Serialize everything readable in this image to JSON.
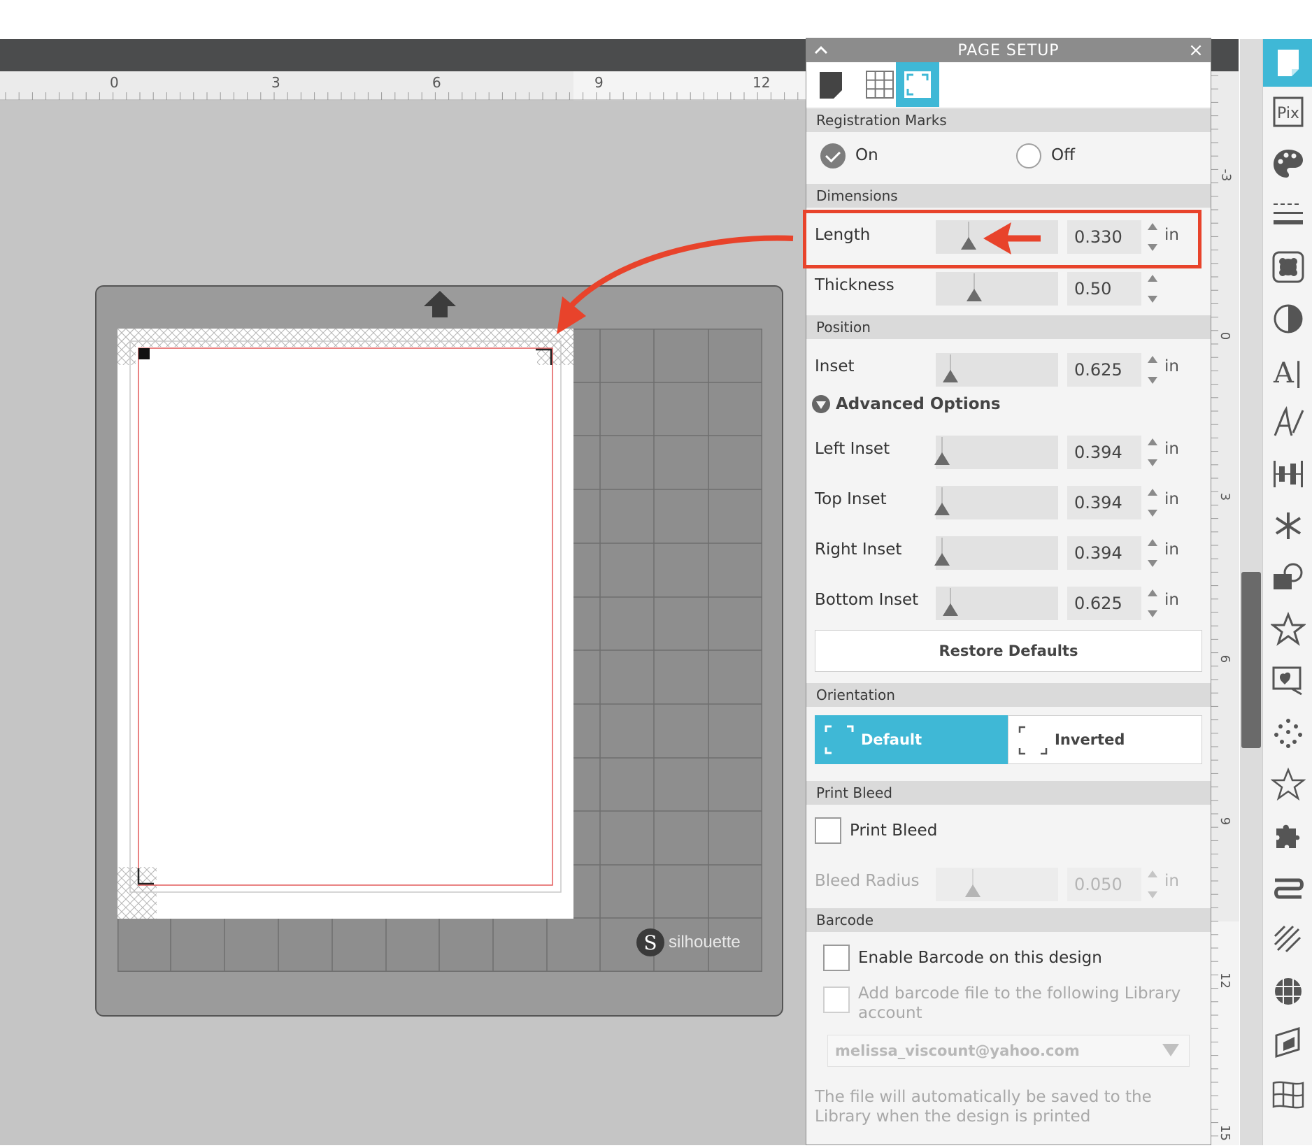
{
  "ruler": {
    "h_ticks": [
      "0",
      "3",
      "6",
      "9",
      "12"
    ],
    "v_ticks": [
      "-3",
      "0",
      "3",
      "6",
      "9",
      "12",
      "15"
    ]
  },
  "mat": {
    "brand": "silhouette",
    "logo_letter": "S"
  },
  "panel": {
    "title": "PAGE SETUP",
    "close_glyph": "×",
    "sections": {
      "registration": "Registration Marks",
      "dimensions": "Dimensions",
      "position": "Position",
      "orientation": "Orientation",
      "print_bleed": "Print Bleed",
      "barcode": "Barcode"
    },
    "registration": {
      "on_label": "On",
      "off_label": "Off",
      "selected": "On"
    },
    "dimensions": {
      "length": {
        "label": "Length",
        "value": "0.330",
        "unit": "in"
      },
      "thickness": {
        "label": "Thickness",
        "value": "0.50"
      }
    },
    "position": {
      "inset": {
        "label": "Inset",
        "value": "0.625",
        "unit": "in"
      },
      "advanced_label": "Advanced Options",
      "left": {
        "label": "Left Inset",
        "value": "0.394",
        "unit": "in"
      },
      "top": {
        "label": "Top Inset",
        "value": "0.394",
        "unit": "in"
      },
      "right": {
        "label": "Right Inset",
        "value": "0.394",
        "unit": "in"
      },
      "bottom": {
        "label": "Bottom Inset",
        "value": "0.625",
        "unit": "in"
      },
      "restore_label": "Restore Defaults"
    },
    "orientation": {
      "default_label": "Default",
      "inverted_label": "Inverted",
      "selected": "Default"
    },
    "print_bleed": {
      "checkbox_label": "Print Bleed",
      "radius_label": "Bleed Radius",
      "radius_value": "0.050",
      "unit": "in"
    },
    "barcode": {
      "enable_label": "Enable Barcode on this design",
      "add_label_line1": "Add barcode file to the following Library",
      "add_label_line2": "account",
      "email": "melissa_viscount@yahoo.com",
      "note_line1": "The file will automatically be saved to the",
      "note_line2": "Library when the design is printed"
    }
  },
  "toolbar": {
    "pix_label": "Pix",
    "text_label": "A|"
  },
  "colors": {
    "accent": "#3fb8d6",
    "callout": "#e8432b",
    "panel_bg": "#f4f4f4"
  }
}
